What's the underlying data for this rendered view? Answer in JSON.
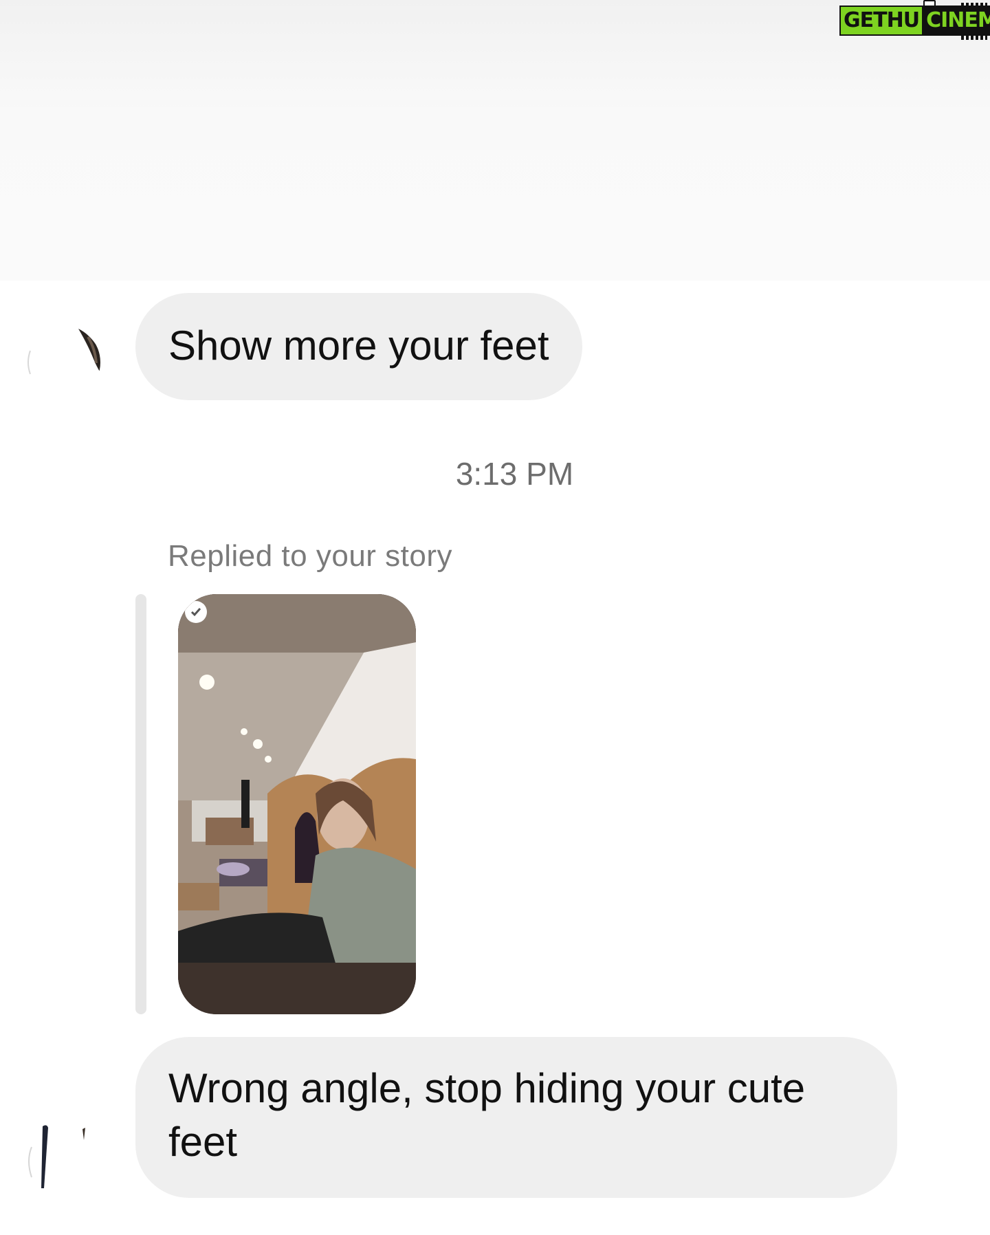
{
  "watermark": {
    "part1": "GETHU",
    "part2": "CINEMA"
  },
  "messages": [
    {
      "sender": "other",
      "text": "Show more your feet"
    },
    {
      "sender": "other",
      "text": "Wrong angle, stop hiding your cute feet"
    }
  ],
  "timestamp": "3:13 PM",
  "story_reply": {
    "label": "Replied to your story",
    "thumbnail": "nail-salon-selfie"
  },
  "colors": {
    "bubble_bg": "#efefef",
    "text": "#111111",
    "meta_text": "#6d6d6d",
    "watermark_green": "#7ed321"
  }
}
